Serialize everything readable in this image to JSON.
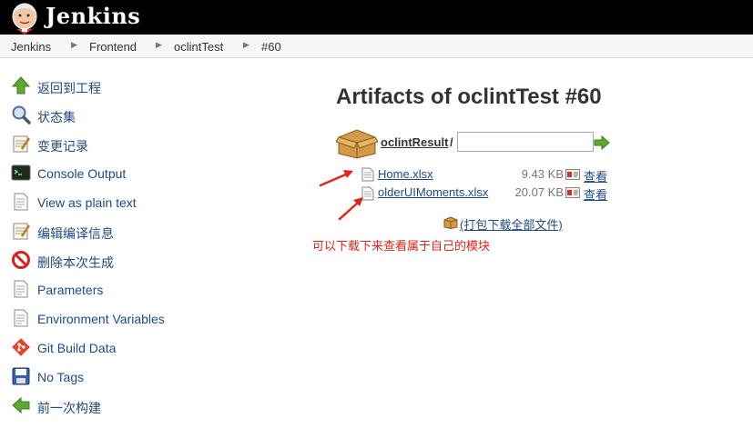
{
  "header": {
    "logo_text": "Jenkins",
    "logo_icon": "jenkins-butler-icon",
    "background": "#000000"
  },
  "breadcrumb": {
    "items": [
      "Jenkins",
      "Frontend",
      "oclintTest",
      "#60"
    ],
    "separator_icon": "triangle-right-icon"
  },
  "sidebar": {
    "items": [
      {
        "label": "返回到工程",
        "icon": "up-arrow-icon"
      },
      {
        "label": "状态集",
        "icon": "magnifier-icon"
      },
      {
        "label": "变更记录",
        "icon": "notepad-icon"
      },
      {
        "label": "Console Output",
        "icon": "terminal-icon"
      },
      {
        "label": "View as plain text",
        "icon": "document-icon"
      },
      {
        "label": "编辑编译信息",
        "icon": "notepad-icon"
      },
      {
        "label": "删除本次生成",
        "icon": "no-entry-icon"
      },
      {
        "label": "Parameters",
        "icon": "document-icon"
      },
      {
        "label": "Environment Variables",
        "icon": "document-icon"
      },
      {
        "label": "Git Build Data",
        "icon": "git-icon"
      },
      {
        "label": "No Tags",
        "icon": "floppy-disk-icon"
      },
      {
        "label": "前一次构建",
        "icon": "left-arrow-icon"
      }
    ]
  },
  "main": {
    "title": "Artifacts of oclintTest #60",
    "folder": {
      "name": "oclintResult",
      "separator": "/",
      "path_value": ""
    },
    "files": [
      {
        "name": "Home.xlsx",
        "size": "9.43 KB",
        "view_label": "查看"
      },
      {
        "name": "olderUIMoments.xlsx",
        "size": "20.07 KB",
        "view_label": "查看"
      }
    ],
    "zip_label": "(打包下载全部文件)",
    "annotation": "可以下载下来查看属于自己的模块"
  },
  "colors": {
    "link": "#204a87",
    "annotation": "#e0251b",
    "accent_green": "#4e9a06"
  }
}
